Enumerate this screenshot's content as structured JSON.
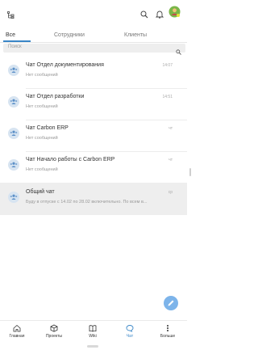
{
  "tabs": [
    {
      "label": "Все",
      "active": true
    },
    {
      "label": "Сотрудники",
      "active": false
    },
    {
      "label": "Клиенты",
      "active": false
    }
  ],
  "search": {
    "placeholder": "Поиск"
  },
  "chats": [
    {
      "title": "Чат Отдел документирования",
      "preview": "Нет сообщений",
      "time": "14:07",
      "active": false
    },
    {
      "title": "Чат Отдел разработки",
      "preview": "Нет сообщений",
      "time": "14:51",
      "active": false
    },
    {
      "title": "Чат Carbon ERP",
      "preview": "Нет сообщений",
      "time": "чт",
      "active": false
    },
    {
      "title": "Чат Начало работы с Carbon ERP",
      "preview": "Нет сообщений",
      "time": "чт",
      "active": false
    },
    {
      "title": "Общий чат",
      "preview": "Буду в отпуске с 14.02 по 28.02 включительно. По всем в...",
      "time": "ср",
      "active": true
    }
  ],
  "bottom_nav": [
    {
      "label": "Главная",
      "icon": "home-icon",
      "active": false
    },
    {
      "label": "Проекты",
      "icon": "box-icon",
      "active": false
    },
    {
      "label": "Wiki",
      "icon": "book-icon",
      "active": false
    },
    {
      "label": "Чат",
      "icon": "chat-icon",
      "active": true
    },
    {
      "label": "Больше",
      "icon": "more-icon",
      "active": false
    }
  ],
  "colors": {
    "accent": "#3b87c7",
    "active_row": "#eeeeee",
    "fab": "#7db4ea",
    "avatar_bg": "#d7e4f1"
  },
  "icons": {
    "topbar_left": "tree-structure-icon",
    "search": "search-icon",
    "notifications": "bell-icon",
    "user": "user-avatar",
    "fab": "pencil-icon"
  }
}
